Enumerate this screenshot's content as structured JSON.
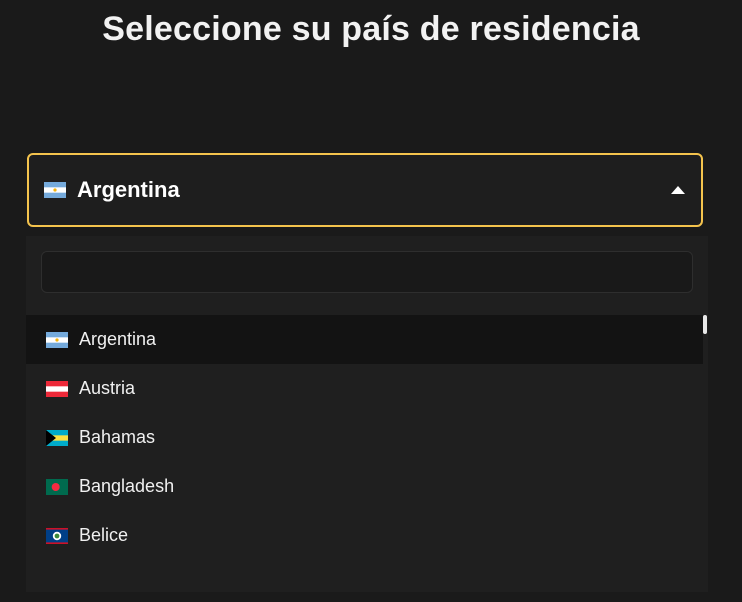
{
  "header": {
    "title": "Seleccione su país de residencia"
  },
  "country_select": {
    "selected_label": "Argentina",
    "selected_flag": "argentina-flag-icon",
    "caret": "caret-up-icon",
    "border_color": "#f4c34d"
  },
  "dropdown": {
    "search": {
      "value": "",
      "placeholder": ""
    },
    "options": [
      {
        "label": "Argentina",
        "flag": "argentina-flag-icon",
        "selected": true
      },
      {
        "label": "Austria",
        "flag": "austria-flag-icon",
        "selected": false
      },
      {
        "label": "Bahamas",
        "flag": "bahamas-flag-icon",
        "selected": false
      },
      {
        "label": "Bangladesh",
        "flag": "bangladesh-flag-icon",
        "selected": false
      },
      {
        "label": "Belice",
        "flag": "belize-flag-icon",
        "selected": false
      }
    ]
  },
  "colors": {
    "background": "#1a1a1a",
    "accent": "#f4c34d",
    "selected_row": "#131313"
  }
}
